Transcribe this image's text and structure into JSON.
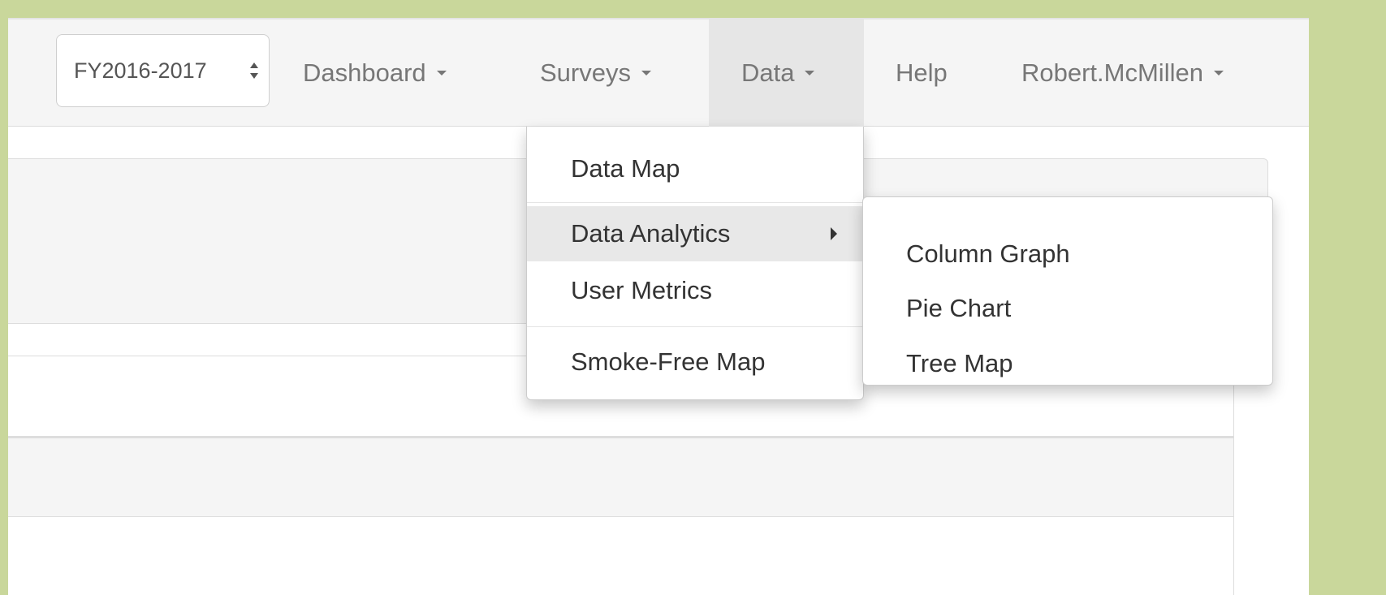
{
  "navbar": {
    "fiscal_year": {
      "value": "FY2016-2017",
      "icon": "updown-arrows-icon"
    },
    "items": [
      {
        "label": "Dashboard",
        "has_caret": true
      },
      {
        "label": "Surveys",
        "has_caret": true
      },
      {
        "label": "Data",
        "has_caret": true,
        "active": true
      },
      {
        "label": "Help",
        "has_caret": false
      },
      {
        "label": "Robert.McMillen",
        "has_caret": true
      }
    ]
  },
  "data_menu": {
    "items": [
      {
        "label": "Data Map"
      },
      {
        "label": "Data Analytics",
        "has_submenu": true,
        "highlighted": true
      },
      {
        "label": "User Metrics"
      },
      {
        "label": "Smoke-Free Map"
      }
    ],
    "submenu_arrow_icon": "caret-right-icon"
  },
  "analytics_submenu": {
    "items": [
      {
        "label": "Column Graph"
      },
      {
        "label": "Pie Chart"
      },
      {
        "label": "Tree Map"
      }
    ]
  },
  "colors": {
    "frame": "#c9d79b",
    "navbar_bg": "#f5f5f5",
    "active_nav_bg": "#e6e6e6",
    "menu_highlight": "#e8e8e8",
    "nav_text": "#777777",
    "menu_text": "#333333"
  }
}
